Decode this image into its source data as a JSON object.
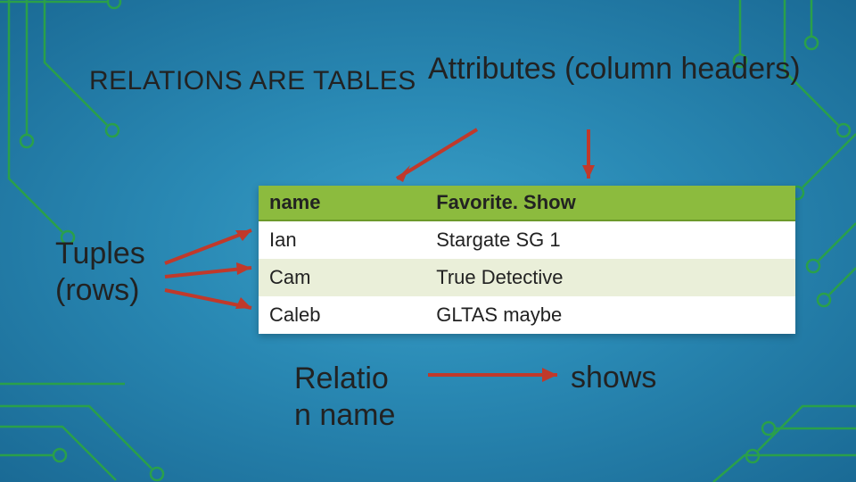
{
  "title": "RELATIONS ARE TABLES",
  "labels": {
    "attributes": "Attributes (column headers)",
    "tuples": "Tuples (rows)",
    "relation_name": "Relatio\nn name",
    "shows": "shows"
  },
  "table": {
    "headers": [
      "name",
      "Favorite. Show"
    ],
    "rows": [
      {
        "name": "Ian",
        "show": "Stargate SG 1"
      },
      {
        "name": "Cam",
        "show": "True Detective"
      },
      {
        "name": "Caleb",
        "show": "GLTAS maybe"
      }
    ]
  },
  "chart_data": {
    "type": "table",
    "title": "RELATIONS ARE TABLES",
    "columns": [
      "name",
      "Favorite. Show"
    ],
    "rows": [
      [
        "Ian",
        "Stargate SG 1"
      ],
      [
        "Cam",
        "True Detective"
      ],
      [
        "Caleb",
        "GLTAS maybe"
      ]
    ],
    "annotations": {
      "attributes_label": "Attributes (column headers)",
      "tuples_label": "Tuples (rows)",
      "relation_name_label": "Relation name",
      "relation_name_value": "shows"
    }
  }
}
